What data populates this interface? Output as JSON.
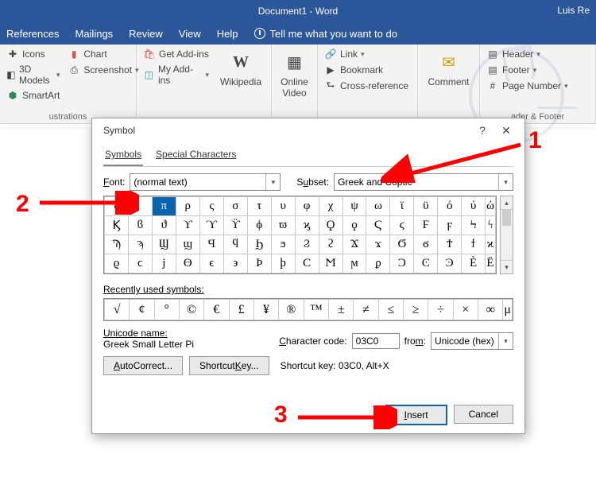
{
  "app": {
    "title": "Document1 - Word",
    "user": "Luis Re"
  },
  "tabstrip": {
    "tabs": [
      "References",
      "Mailings",
      "Review",
      "View",
      "Help"
    ],
    "tell": "Tell me what you want to do"
  },
  "ribbon": {
    "illustrations": {
      "icons": "Icons",
      "models": "3D Models",
      "smartart": "SmartArt",
      "chart": "Chart",
      "screenshot": "Screenshot",
      "group": "ustrations"
    },
    "addins": {
      "get": "Get Add-ins",
      "my": "My Add-ins",
      "wiki": "Wikipedia"
    },
    "media": {
      "video": "Online\nVideo"
    },
    "links": {
      "link": "Link",
      "bookmark": "Bookmark",
      "xref": "Cross-reference"
    },
    "comments": {
      "comment": "Comment"
    },
    "hf": {
      "header": "Header",
      "footer": "Footer",
      "pagenum": "Page Number",
      "group": "ader & Footer"
    }
  },
  "dialog": {
    "title": "Symbol",
    "tabs": {
      "symbols": "Symbols",
      "special": "Special Characters"
    },
    "font_label": "Font:",
    "font_value": "(normal text)",
    "subset_label": "Subset:",
    "subset_value": "Greek and Coptic",
    "grid": [
      [
        "ς",
        "",
        "π",
        "ρ",
        "ς",
        "σ",
        "τ",
        "υ",
        "φ",
        "χ",
        "ψ",
        "ω",
        "ϊ",
        "ϋ",
        "ό",
        "ύ",
        "ώ"
      ],
      [
        "Ϗ",
        "ϐ",
        "ϑ",
        "ϒ",
        "ϓ",
        "ϔ",
        "ϕ",
        "ϖ",
        "ϗ",
        "Ϙ",
        "ϙ",
        "Ϛ",
        "ϛ",
        "Ϝ",
        "ϝ",
        "Ϟ",
        "ϟ"
      ],
      [
        "Ϡ",
        "ϡ",
        "Ϣ",
        "ϣ",
        "Ϥ",
        "ϥ",
        "Ϧ",
        "ϧ",
        "Ϩ",
        "ϩ",
        "Ϫ",
        "ϫ",
        "Ϭ",
        "ϭ",
        "Ϯ",
        "ϯ",
        "ϰ"
      ],
      [
        "ϱ",
        "ϲ",
        "ϳ",
        "ϴ",
        "ϵ",
        "϶",
        "Ϸ",
        "ϸ",
        "Ϲ",
        "Ϻ",
        "ϻ",
        "ϼ",
        "Ͻ",
        "Ͼ",
        "Ͽ",
        "Ѐ",
        "Ё"
      ]
    ],
    "selected": {
      "row": 0,
      "col": 2
    },
    "recent_label": "Recently used symbols:",
    "recent": [
      "√",
      "¢",
      "°",
      "©",
      "€",
      "£",
      "¥",
      "®",
      "™",
      "±",
      "≠",
      "≤",
      "≥",
      "÷",
      "×",
      "∞",
      "μ"
    ],
    "unicode_lbl": "Unicode name:",
    "unicode_name": "Greek Small Letter Pi",
    "code_lbl": "Character code:",
    "code_val": "03C0",
    "from_lbl": "from:",
    "from_val": "Unicode (hex)",
    "autocorrect": "AutoCorrect...",
    "shortcutkey": "Shortcut Key...",
    "shortcut_txt": "Shortcut key: 03C0, Alt+X",
    "insert": "Insert",
    "cancel": "Cancel"
  },
  "annotations": {
    "n1": "1",
    "n2": "2",
    "n3": "3"
  }
}
